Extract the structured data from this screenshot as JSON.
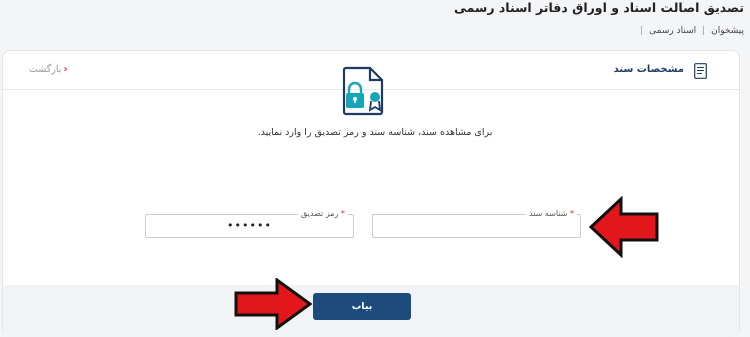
{
  "page": {
    "title": "تصدیق اصالت اسناد و اوراق دفاتر اسناد رسمی"
  },
  "breadcrumb": {
    "items": [
      "پیشخوان",
      "اسناد رسمی"
    ],
    "separator": "|"
  },
  "card": {
    "title": "مشخصات سند",
    "back_label": "بازگشت",
    "instruction": "برای مشاهده سند، شناسه سند و رمز تصدیق را وارد نمایید."
  },
  "form": {
    "doc_id": {
      "label": "شناسه سند",
      "required_mark": "*",
      "value": ""
    },
    "verify_code": {
      "label": "رمز تصدیق",
      "required_mark": "*",
      "value": "••••••"
    },
    "submit_label": "بیاب"
  },
  "colors": {
    "accent": "#1c4b7c",
    "icon_teal": "#19a5b8",
    "icon_navy": "#1f3b63",
    "required": "#e0232d",
    "arrow_red": "#e3161c"
  },
  "icons": [
    "document-icon",
    "chevron-right-icon",
    "lock-certificate-icon",
    "red-arrow-left",
    "red-arrow-right"
  ]
}
